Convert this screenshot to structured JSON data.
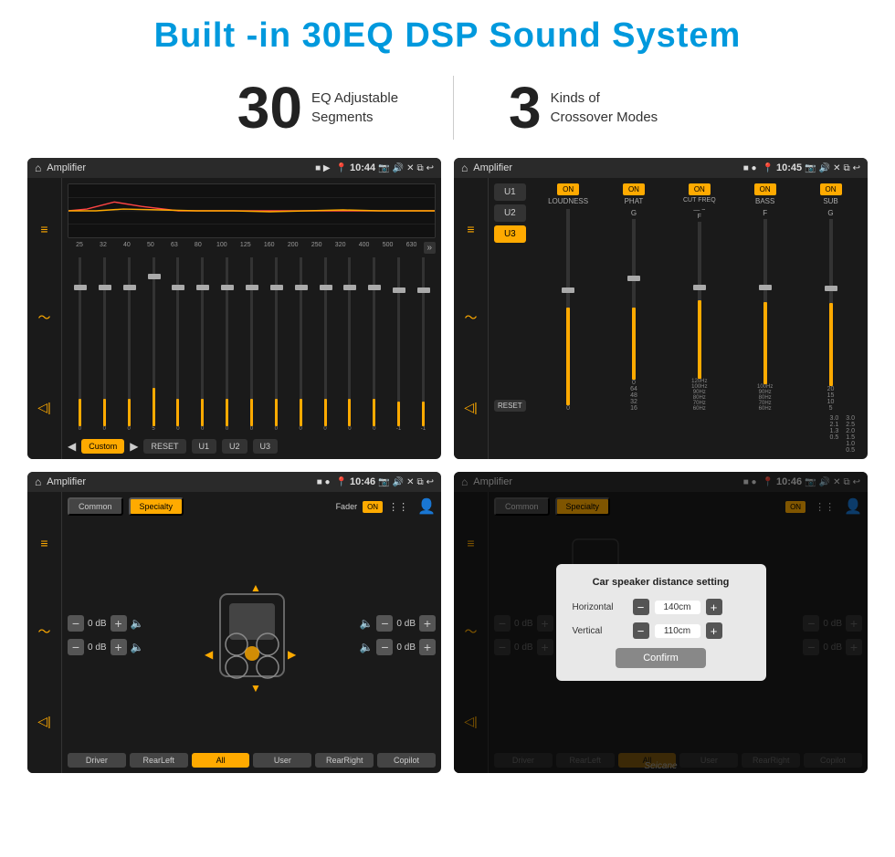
{
  "header": {
    "title": "Built -in 30EQ DSP Sound System"
  },
  "stats": {
    "eq_number": "30",
    "eq_desc_line1": "EQ Adjustable",
    "eq_desc_line2": "Segments",
    "crossover_number": "3",
    "crossover_desc_line1": "Kinds of",
    "crossover_desc_line2": "Crossover Modes"
  },
  "screens": {
    "screen1": {
      "app": "Amplifier",
      "time": "10:44",
      "eq_frequencies": [
        "25",
        "32",
        "40",
        "50",
        "63",
        "80",
        "100",
        "125",
        "160",
        "200",
        "250",
        "320",
        "400",
        "500",
        "630"
      ],
      "eq_values": [
        "0",
        "0",
        "0",
        "5",
        "0",
        "0",
        "0",
        "0",
        "0",
        "0",
        "0",
        "0",
        "0",
        "-1",
        "0",
        "-1"
      ],
      "bottom_btns": [
        "Custom",
        "RESET",
        "U1",
        "U2",
        "U3"
      ]
    },
    "screen2": {
      "app": "Amplifier",
      "time": "10:45",
      "presets": [
        "U1",
        "U2",
        "U3"
      ],
      "active_preset": "U3",
      "channels": [
        "LOUDNESS",
        "PHAT",
        "CUT FREQ",
        "BASS",
        "SUB"
      ],
      "reset_btn": "RESET"
    },
    "screen3": {
      "app": "Amplifier",
      "time": "10:46",
      "tabs": [
        "Common",
        "Specialty"
      ],
      "active_tab": "Specialty",
      "fader_label": "Fader",
      "fader_on": "ON",
      "vol_rows": [
        {
          "label": "0 dB",
          "side": "left"
        },
        {
          "label": "0 dB",
          "side": "left"
        },
        {
          "label": "0 dB",
          "side": "right"
        },
        {
          "label": "0 dB",
          "side": "right"
        }
      ],
      "bottom_btns": [
        "Driver",
        "RearLeft",
        "All",
        "User",
        "RearRight",
        "Copilot"
      ],
      "all_active": true
    },
    "screen4": {
      "app": "Amplifier",
      "time": "10:46",
      "tabs": [
        "Common",
        "Specialty"
      ],
      "active_tab": "Specialty",
      "dialog": {
        "title": "Car speaker distance setting",
        "horizontal_label": "Horizontal",
        "horizontal_value": "140cm",
        "vertical_label": "Vertical",
        "vertical_value": "110cm",
        "confirm_btn": "Confirm"
      },
      "bottom_btns": [
        "Driver",
        "RearLeft",
        "All",
        "User",
        "RearRight",
        "Copilot"
      ]
    }
  },
  "watermark": "Seicane"
}
